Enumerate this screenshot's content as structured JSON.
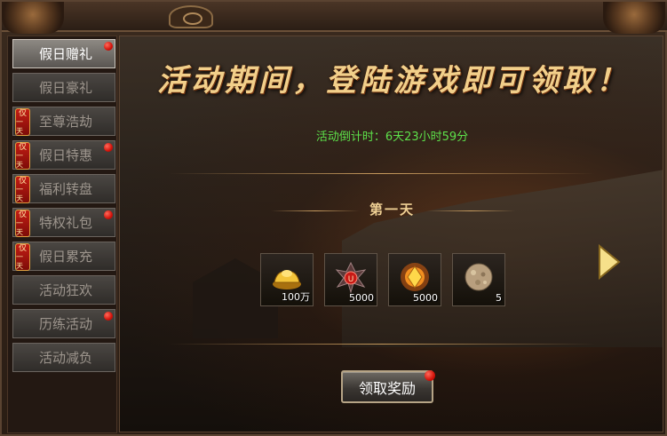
{
  "sidebar": {
    "tabs": [
      {
        "label": "假日赠礼",
        "active": true,
        "only_badge": false,
        "dot": true
      },
      {
        "label": "假日豪礼",
        "active": false,
        "only_badge": false,
        "dot": false
      },
      {
        "label": "至尊浩劫",
        "active": false,
        "only_badge": true,
        "dot": false
      },
      {
        "label": "假日特惠",
        "active": false,
        "only_badge": true,
        "dot": true
      },
      {
        "label": "福利转盘",
        "active": false,
        "only_badge": true,
        "dot": false
      },
      {
        "label": "特权礼包",
        "active": false,
        "only_badge": true,
        "dot": true
      },
      {
        "label": "假日累充",
        "active": false,
        "only_badge": true,
        "dot": false
      },
      {
        "label": "活动狂欢",
        "active": false,
        "only_badge": false,
        "dot": false
      },
      {
        "label": "历练活动",
        "active": false,
        "only_badge": false,
        "dot": true
      },
      {
        "label": "活动减负",
        "active": false,
        "only_badge": false,
        "dot": false
      }
    ],
    "only_badge_top": "仅",
    "only_badge_bottom": "一天"
  },
  "main": {
    "headline": "活动期间，登陆游戏即可领取！",
    "countdown": "活动倒计时：6天23小时59分",
    "day_title": "第一天",
    "rewards": [
      {
        "icon": "gold-ingot-icon",
        "qty": "100万"
      },
      {
        "icon": "red-gem-emblem-icon",
        "qty": "5000"
      },
      {
        "icon": "fire-crystal-icon",
        "qty": "5000"
      },
      {
        "icon": "stone-orb-icon",
        "qty": "5"
      }
    ],
    "claim_label": "领取奖励"
  },
  "colors": {
    "countdown": "#5de04a",
    "headline": "#f2cf8a",
    "badge_red": "#c41d14"
  }
}
